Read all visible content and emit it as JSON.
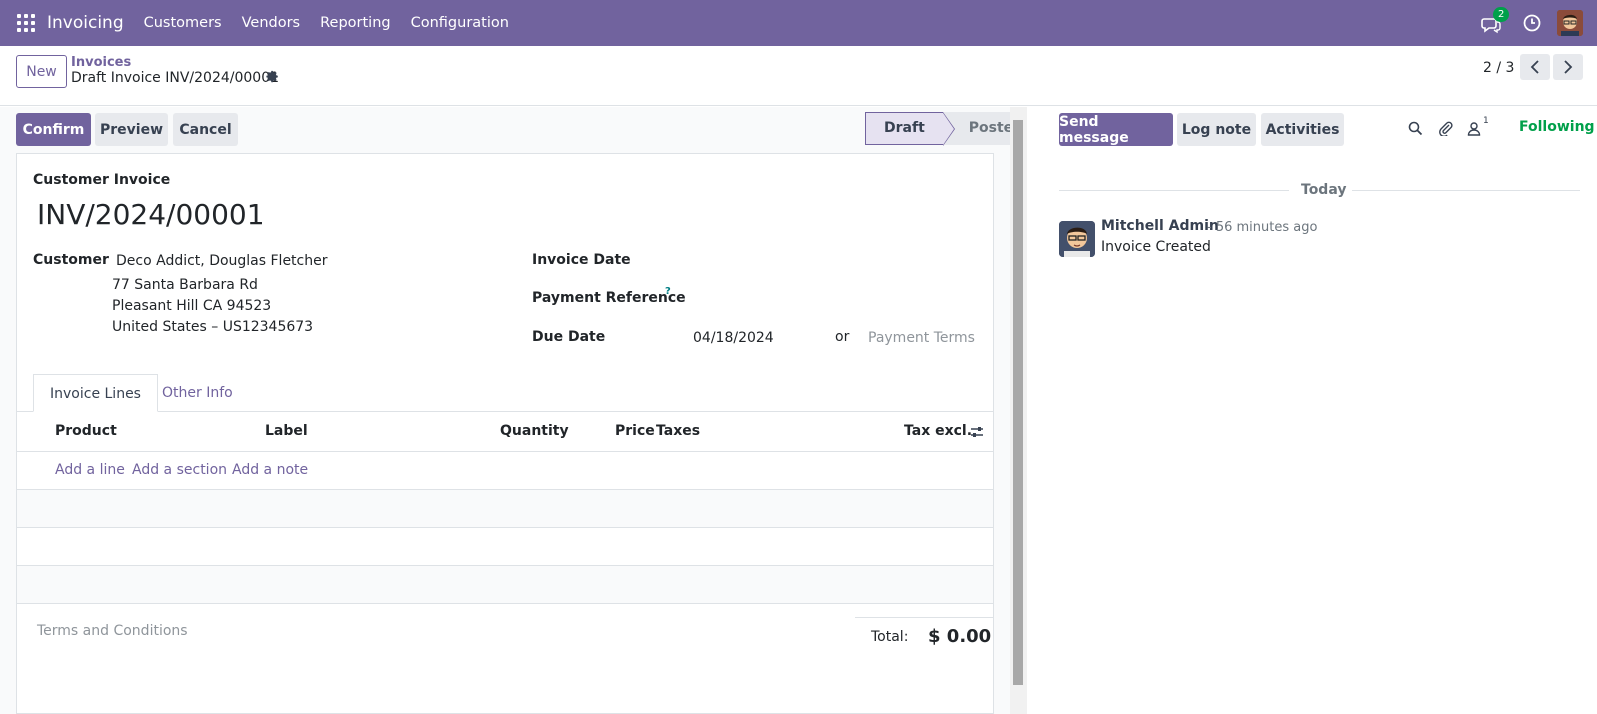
{
  "navbar": {
    "app_name": "Invoicing",
    "menus": [
      "Customers",
      "Vendors",
      "Reporting",
      "Configuration"
    ],
    "chat_badge": "2",
    "color": "#71639e"
  },
  "control_panel": {
    "new_label": "New",
    "breadcrumb_parent": "Invoices",
    "breadcrumb_current": "Draft Invoice INV/2024/00001",
    "pager": "2 / 3"
  },
  "form": {
    "buttons": {
      "confirm": "Confirm",
      "preview": "Preview",
      "cancel": "Cancel"
    },
    "status": {
      "draft": "Draft",
      "posted": "Posted"
    },
    "doc_type": "Customer Invoice",
    "name": "INV/2024/00001",
    "customer_label": "Customer",
    "customer_name": "Deco Addict, Douglas Fletcher",
    "address": [
      "77 Santa Barbara Rd",
      "Pleasant Hill CA 94523",
      "United States – US12345673"
    ],
    "invoice_date_label": "Invoice Date",
    "payment_ref_label": "Payment Reference",
    "payment_ref_help": "?",
    "due_date_label": "Due Date",
    "due_date": "04/18/2024",
    "or_label": "or",
    "payment_terms_placeholder": "Payment Terms",
    "tabs": {
      "lines": "Invoice Lines",
      "other": "Other Info"
    },
    "columns": {
      "product": "Product",
      "label": "Label",
      "quantity": "Quantity",
      "price": "Price",
      "taxes": "Taxes",
      "tax_excl": "Tax excl."
    },
    "add_links": {
      "line": "Add a line",
      "section": "Add a section",
      "note": "Add a note"
    },
    "terms_placeholder": "Terms and Conditions",
    "total_label": "Total:",
    "total_value": "$ 0.00"
  },
  "chatter": {
    "send_message": "Send message",
    "log_note": "Log note",
    "activities": "Activities",
    "followers_count": "1",
    "following": "Following",
    "today": "Today",
    "message": {
      "author": "Mitchell Admin",
      "date": "- 56 minutes ago",
      "body": "Invoice Created"
    }
  }
}
